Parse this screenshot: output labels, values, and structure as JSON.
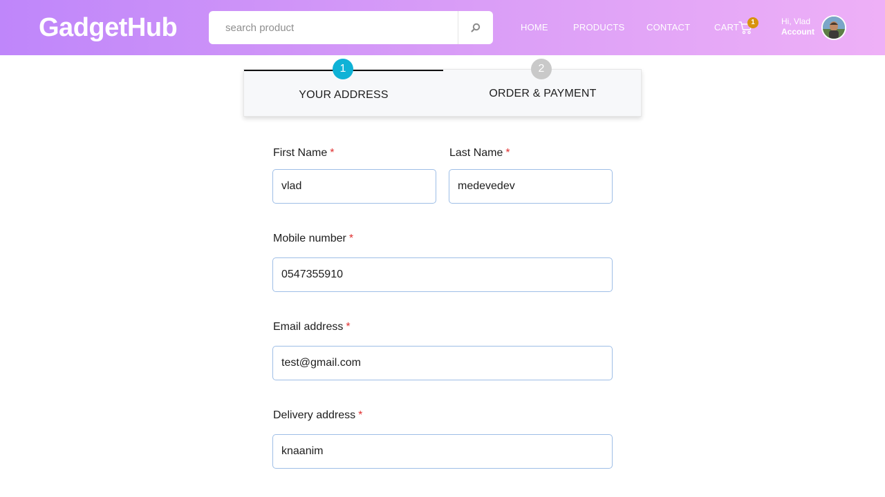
{
  "header": {
    "logo": "GadgetHub",
    "search_placeholder": "search product",
    "search_icon": "search-icon",
    "nav": {
      "home": "HOME",
      "products": "PRODUCTS",
      "contact": "CONTACT",
      "cart": "CART",
      "cart_count": "1"
    },
    "greeting": "Hi, Vlad",
    "account": "Account",
    "colors": {
      "gradient_start": "#bf86fa",
      "gradient_end": "#eeb0f7",
      "badge": "#d8930d"
    }
  },
  "stepper": {
    "steps": [
      {
        "number": "1",
        "label": "YOUR ADDRESS",
        "active": true
      },
      {
        "number": "2",
        "label": "ORDER & PAYMENT",
        "active": false
      }
    ],
    "colors": {
      "active": "#0fb2d6",
      "inactive": "#c9c9c9"
    }
  },
  "form": {
    "required_marker": "*",
    "first_name": {
      "label": "First Name",
      "value": "vlad"
    },
    "last_name": {
      "label": "Last Name",
      "value": "medevedev"
    },
    "mobile": {
      "label": "Mobile number",
      "value": "0547355910"
    },
    "email": {
      "label": "Email address",
      "value": "test@gmail.com"
    },
    "address": {
      "label": "Delivery address",
      "value": "knaanim"
    }
  }
}
